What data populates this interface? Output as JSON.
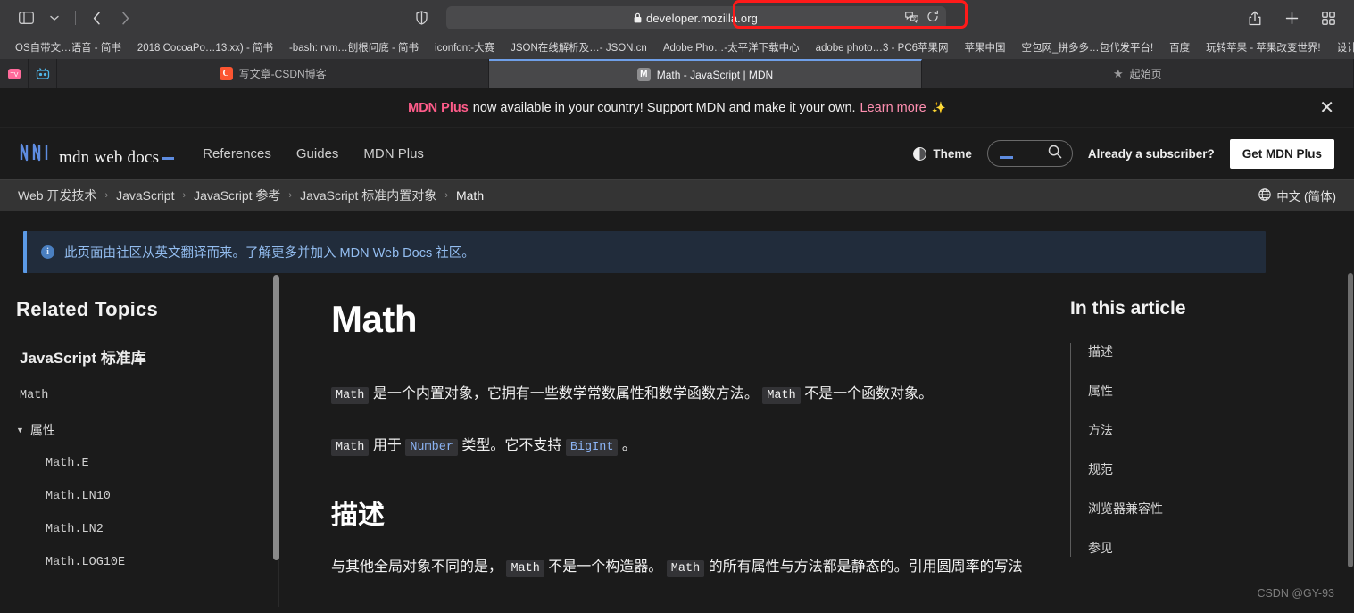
{
  "browser": {
    "name": "Safari",
    "toolbar": {
      "sidebar_icon": "sidebar-icon",
      "tab_overview_chevron": "chevron-down-icon",
      "back_icon": "back-chevron-icon",
      "forward_icon": "forward-chevron-icon",
      "shield_icon": "privacy-shield-icon",
      "url": "developer.mozilla.org",
      "lock_icon": "lock-icon",
      "translate_icon": "translate-icon",
      "reload_icon": "reload-icon",
      "share_icon": "share-icon",
      "new_tab_icon": "plus-icon",
      "tab_grid_icon": "tab-grid-icon",
      "highlight_color": "#ff1a1a"
    },
    "bookmarks": [
      "OS自带文…语音 - 简书",
      "2018 CocoaPo…13.xx) - 简书",
      "-bash: rvm…刨根问底 - 简书",
      "iconfont-大赛",
      "JSON在线解析及…- JSON.cn",
      "Adobe Pho…-太平洋下载中心",
      "adobe photo…3 - PC6苹果网",
      "苹果中国",
      "空包网_拼多多…包代发平台!",
      "百度",
      "玩转苹果 - 苹果改变世界!",
      "设计"
    ],
    "bookmarks_overflow": "»",
    "tabs": [
      {
        "title": "写文章-CSDN博客",
        "favicon": "C",
        "favicon_type": "csdn",
        "active": false
      },
      {
        "title": "Math - JavaScript | MDN",
        "favicon": "M",
        "favicon_type": "mdn",
        "active": true
      },
      {
        "title": "起始页",
        "favicon": "★",
        "favicon_type": "star",
        "active": false
      }
    ]
  },
  "banner": {
    "brand": "MDN Plus",
    "text": " now available in your country! Support MDN and make it your own.",
    "link": "Learn more",
    "sparkle": "✨",
    "close_icon": "close-icon",
    "brand_color": "#ff5c8a"
  },
  "header": {
    "logo_mark": "/\\/\\/",
    "logo_text": "mdn web docs",
    "nav": [
      {
        "label": "References"
      },
      {
        "label": "Guides"
      },
      {
        "label": "MDN Plus"
      }
    ],
    "theme_label": "Theme",
    "theme_icon": "half-circle-icon",
    "search_icon": "search-icon",
    "search_placeholder": "",
    "subscriber_text": "Already a subscriber?",
    "cta_label": "Get MDN Plus"
  },
  "breadcrumb": {
    "items": [
      {
        "label": "Web 开发技术",
        "current": false
      },
      {
        "label": "JavaScript",
        "current": false
      },
      {
        "label": "JavaScript 参考",
        "current": false
      },
      {
        "label": "JavaScript 标准内置对象",
        "current": false
      },
      {
        "label": "Math",
        "current": true
      }
    ],
    "separator": "›",
    "language_icon": "globe-icon",
    "language_label": "中文 (简体)"
  },
  "notice": {
    "icon": "info-icon",
    "text": "此页面由社区从英文翻译而来。了解更多并加入 MDN Web Docs 社区。",
    "accent_color": "#5b9ae6"
  },
  "sidebar": {
    "title": "Related Topics",
    "subtitle": "JavaScript 标准库",
    "top_link": "Math",
    "group": {
      "triangle": "▼",
      "label": "属性"
    },
    "items": [
      {
        "label": "Math.E"
      },
      {
        "label": "Math.LN10"
      },
      {
        "label": "Math.LN2"
      },
      {
        "label": "Math.LOG10E"
      }
    ]
  },
  "article": {
    "title": "Math",
    "p1": {
      "c1": "Math",
      "t1": " 是一个内置对象，它拥有一些数学常数属性和数学函数方法。 ",
      "c2": "Math",
      "t2": " 不是一个函数对象。"
    },
    "p2": {
      "c1": "Math",
      "t1": " 用于 ",
      "link1": "Number",
      "t2": " 类型。它不支持 ",
      "link2": "BigInt",
      "t3": " 。"
    },
    "h2": "描述",
    "p3": {
      "t1": "与其他全局对象不同的是， ",
      "c1": "Math",
      "t2": " 不是一个构造器。 ",
      "c2": "Math",
      "t3": " 的所有属性与方法都是静态的。引用圆周率的写法"
    }
  },
  "toc": {
    "title": "In this article",
    "items": [
      {
        "label": "描述"
      },
      {
        "label": "属性"
      },
      {
        "label": "方法"
      },
      {
        "label": "规范"
      },
      {
        "label": "浏览器兼容性"
      },
      {
        "label": "参见"
      }
    ]
  },
  "watermark": "CSDN @GY-93"
}
